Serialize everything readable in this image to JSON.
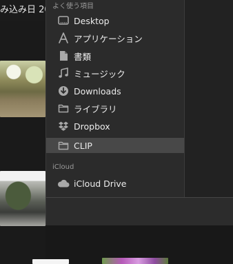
{
  "background": {
    "title": "み込み日 20"
  },
  "sidebar": {
    "favorites_header": "よく使う項目",
    "items": [
      {
        "label": "Desktop",
        "icon": "desktop-icon"
      },
      {
        "label": "アプリケーション",
        "icon": "applications-icon"
      },
      {
        "label": "書類",
        "icon": "documents-icon"
      },
      {
        "label": "ミュージック",
        "icon": "music-icon"
      },
      {
        "label": "Downloads",
        "icon": "downloads-icon"
      },
      {
        "label": "ライブラリ",
        "icon": "folder-icon"
      },
      {
        "label": "Dropbox",
        "icon": "dropbox-icon"
      },
      {
        "label": "CLIP",
        "icon": "folder-icon",
        "selected": true
      }
    ],
    "icloud_header": "iCloud",
    "icloud_items": [
      {
        "label": "iCloud Drive",
        "icon": "cloud-icon"
      }
    ]
  },
  "colors": {
    "popover_bg": "#2b2b2b",
    "selected_bg": "#484848",
    "text": "#ececec",
    "header_text": "#9a9a9a",
    "icon": "#a9a9a9"
  }
}
